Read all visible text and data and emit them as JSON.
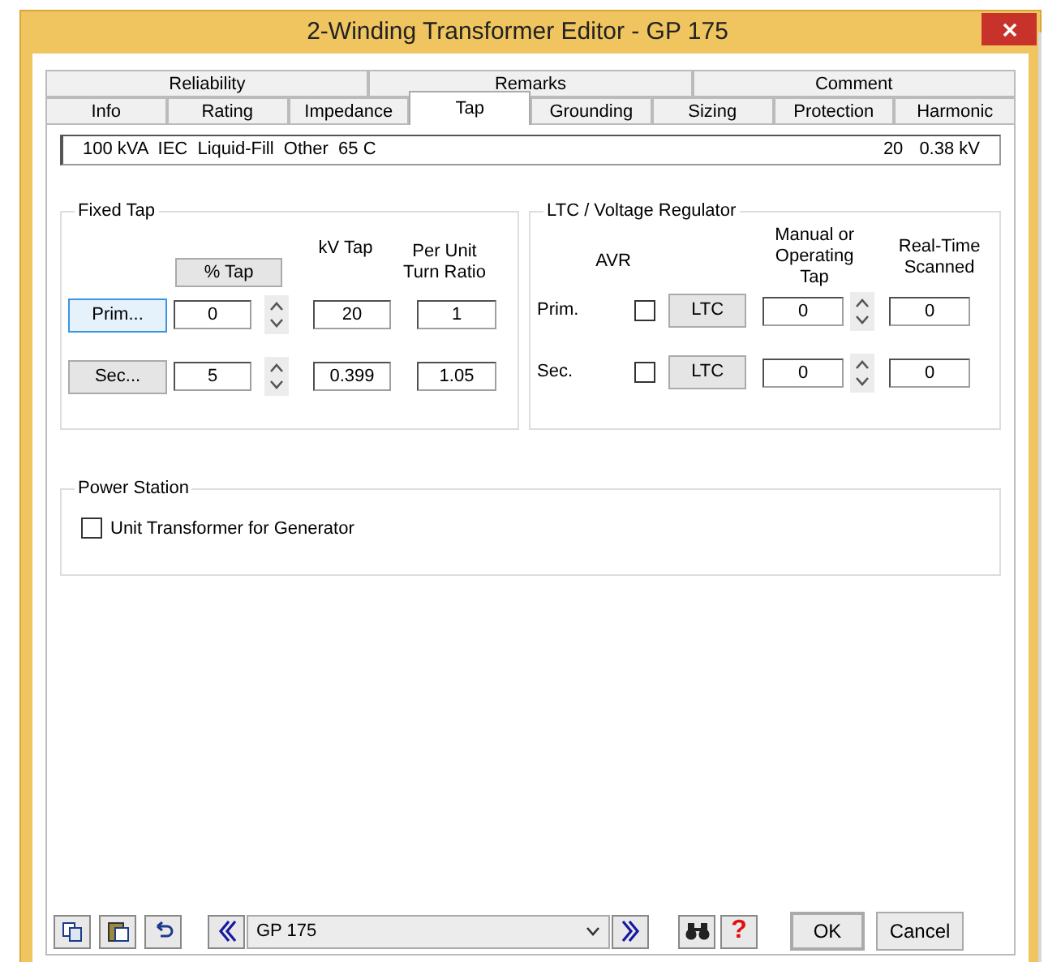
{
  "window": {
    "title": "2-Winding Transformer Editor - GP 175"
  },
  "tab_rows": [
    [
      {
        "label": "Reliability",
        "selected": false
      },
      {
        "label": "Remarks",
        "selected": false
      },
      {
        "label": "Comment",
        "selected": false
      }
    ],
    [
      {
        "label": "Info",
        "selected": false
      },
      {
        "label": "Rating",
        "selected": false
      },
      {
        "label": "Impedance",
        "selected": false
      },
      {
        "label": "Tap",
        "selected": true
      },
      {
        "label": "Grounding",
        "selected": false
      },
      {
        "label": "Sizing",
        "selected": false
      },
      {
        "label": "Protection",
        "selected": false
      },
      {
        "label": "Harmonic",
        "selected": false
      }
    ]
  ],
  "info_bar": {
    "summary": "100 kVA  IEC  Liquid-Fill  Other  65 C",
    "rated": "20",
    "voltage": "0.38 kV"
  },
  "fixed_tap": {
    "title": "Fixed Tap",
    "percent_button": "% Tap",
    "kv_header": "kV Tap",
    "ratio_header": "Per Unit Turn Ratio",
    "rows": [
      {
        "button": "Prim...",
        "focused": true,
        "percent": "0",
        "kv": "20",
        "ratio": "1"
      },
      {
        "button": "Sec...",
        "focused": false,
        "percent": "5",
        "kv": "0.399",
        "ratio": "1.05"
      }
    ]
  },
  "ltc": {
    "title": "LTC / Voltage Regulator",
    "avr_header": "AVR",
    "tap_header": "Manual or Operating Tap",
    "scanned_header": "Real-Time Scanned",
    "rows": [
      {
        "label": "Prim.",
        "avr": false,
        "button": "LTC",
        "tap": "0",
        "scanned": "0"
      },
      {
        "label": "Sec.",
        "avr": false,
        "button": "LTC",
        "tap": "0",
        "scanned": "0"
      }
    ]
  },
  "power_station": {
    "title": "Power Station",
    "checkbox": {
      "label": "Unit Transformer for Generator",
      "checked": false
    }
  },
  "footer": {
    "selector": "GP 175",
    "help": "?",
    "ok": "OK",
    "cancel": "Cancel"
  }
}
